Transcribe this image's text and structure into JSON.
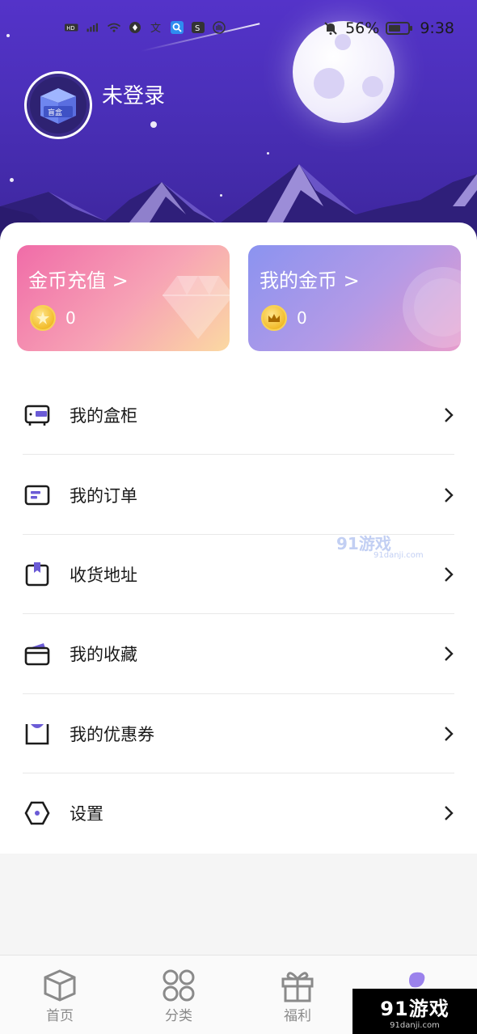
{
  "status_bar": {
    "battery": "56%",
    "time": "9:38"
  },
  "profile": {
    "avatar_label": "盲盒",
    "login_text": "未登录"
  },
  "coin_cards": [
    {
      "title": "金币充值 >",
      "value": "0"
    },
    {
      "title": "我的金币 >",
      "value": "0"
    }
  ],
  "menu": [
    {
      "label": "我的盒柜",
      "icon": "box-cabinet-icon"
    },
    {
      "label": "我的订单",
      "icon": "order-icon"
    },
    {
      "label": "收货地址",
      "icon": "address-bookmark-icon"
    },
    {
      "label": "我的收藏",
      "icon": "favorites-wallet-icon"
    },
    {
      "label": "我的优惠券",
      "icon": "coupon-icon"
    },
    {
      "label": "设置",
      "icon": "settings-hexagon-icon"
    }
  ],
  "tabbar": [
    {
      "label": "首页",
      "icon": "cube-icon"
    },
    {
      "label": "分类",
      "icon": "category-grid-icon"
    },
    {
      "label": "福利",
      "icon": "gift-icon"
    },
    {
      "label": "",
      "icon": "profile-icon"
    }
  ],
  "watermark": {
    "brand": "91游戏",
    "site": "91danji.com"
  },
  "colors": {
    "hero_purple": "#5433c9",
    "accent_purple": "#7d5ee0",
    "recharge_pink": "#f06ca8",
    "mine_violet": "#8b93f0"
  }
}
